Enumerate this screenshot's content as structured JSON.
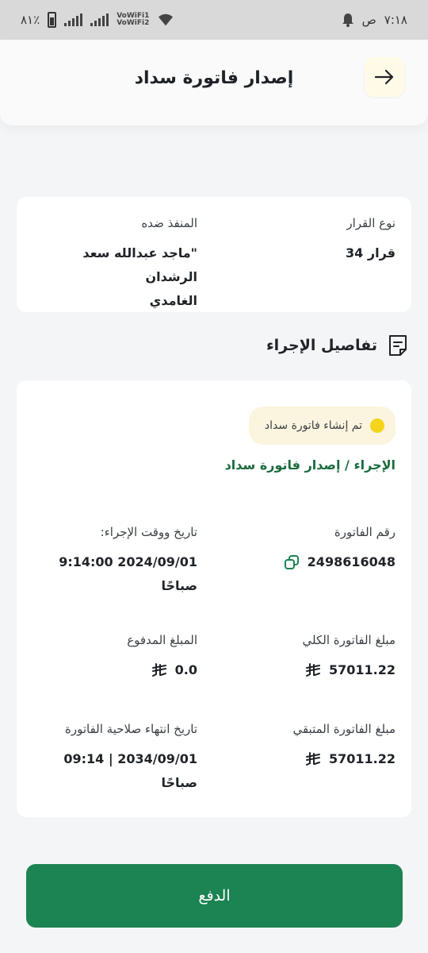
{
  "status_bar": {
    "time": "٧:١٨",
    "period": "ص",
    "battery": "٨١٪",
    "network_1": "VoWiFi1",
    "network_2": "VoWiFi2"
  },
  "header": {
    "title": "إصدار فاتورة سداد"
  },
  "decision": {
    "type_label": "نوع القرار",
    "type_value": "قرار 34",
    "executed_label": "المنفذ ضده",
    "executed_value_line1": "\"ماجد  عبدالله سعد الرشدان",
    "executed_value_line2": "الغامدي"
  },
  "section": {
    "title": "تفاصيل الإجراء"
  },
  "details": {
    "status": "تم إنشاء فاتورة سداد",
    "procedure": "الإجراء / إصدار فاتورة سداد",
    "invoice_number_label": "رقم الفاتورة",
    "invoice_number_value": "2498616048",
    "procedure_datetime_label": "تاريخ ووقت الإجراء:",
    "procedure_datetime_line1": "9:14:00 2024/09/01",
    "procedure_datetime_line2": "صباحًا",
    "total_amount_label": "مبلغ الفاتورة الكلي",
    "total_amount_value": "57011.22",
    "paid_amount_label": "المبلغ المدفوع",
    "paid_amount_value": "0.0",
    "remaining_amount_label": "مبلغ الفاتورة المتبقي",
    "remaining_amount_value": "57011.22",
    "expiry_label": "تاريخ انتهاء صلاحية الفاتورة",
    "expiry_line1": "09:14 | 2034/09/01",
    "expiry_line2": "صباحًا"
  },
  "actions": {
    "pay_label": "الدفع"
  },
  "colors": {
    "primary_green": "#1c8352",
    "procedure_green": "#1c6b3e",
    "status_yellow": "#f5d51b",
    "status_pill_bg": "#fbf4de"
  },
  "icons": {
    "back": "arrow-right-icon",
    "section": "document-icon",
    "copy": "copy-icon",
    "currency": "saudi-riyal-icon"
  }
}
